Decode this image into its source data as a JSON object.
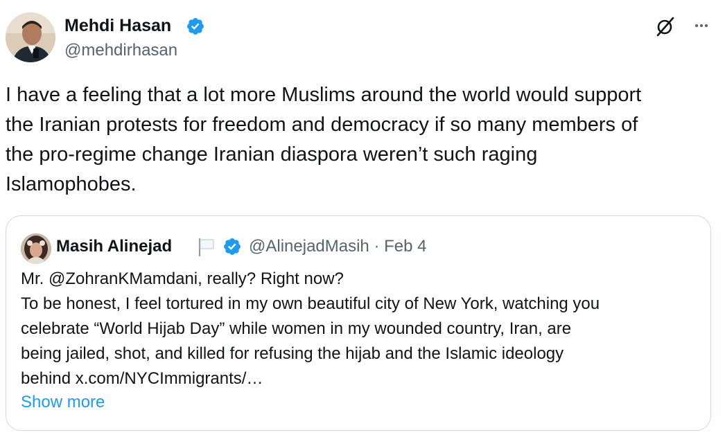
{
  "author": {
    "display_name": "Mehdi Hasan",
    "handle": "@mehdirhasan",
    "verified_icon": "verified-badge-icon"
  },
  "tweet": {
    "text_lines": [
      "I have a feeling that a lot more Muslims around the world would support",
      "the Iranian protests for freedom and democracy if so many members of",
      "the pro-regime change Iranian diaspora weren’t such raging",
      "Islamophobes."
    ]
  },
  "quoted": {
    "display_name": "Masih Alinejad",
    "flag_icon": "white-flag-icon",
    "handle": "@AlinejadMasih",
    "separator": "·",
    "date": "Feb 4",
    "text_lines": [
      "Mr. @ZohranKMamdani, really? Right now?",
      "To be honest, I feel tortured in my own beautiful city of New York, watching you",
      "celebrate “World Hijab Day” while women in my wounded country, Iran, are",
      "being jailed, shot, and killed for refusing the hijab and the Islamic ideology",
      "behind x.com/NYCImmigrants/…"
    ],
    "show_more": "Show more"
  },
  "colors": {
    "text": "#0f1419",
    "secondary": "#536471",
    "link": "#1d9bf0",
    "verified": "#1d9bf0",
    "border": "#cfd9de"
  }
}
